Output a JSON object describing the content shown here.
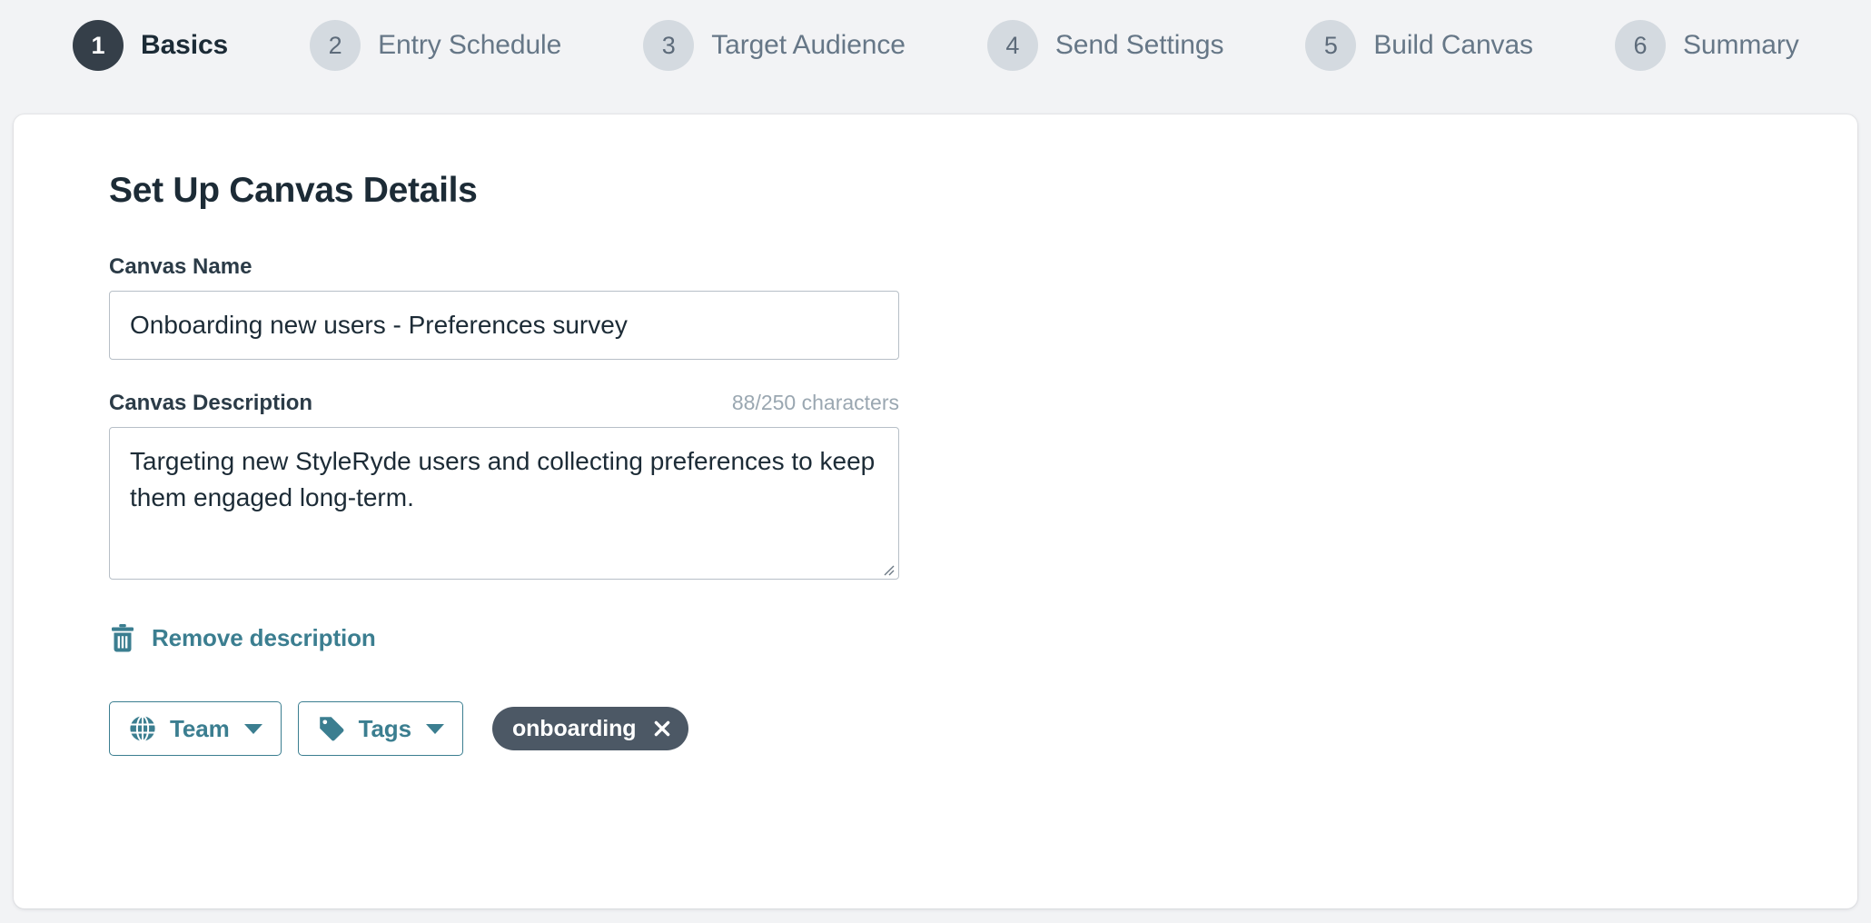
{
  "stepper": {
    "steps": [
      {
        "number": "1",
        "label": "Basics",
        "state": "active"
      },
      {
        "number": "2",
        "label": "Entry Schedule",
        "state": "inactive"
      },
      {
        "number": "3",
        "label": "Target Audience",
        "state": "inactive"
      },
      {
        "number": "4",
        "label": "Send Settings",
        "state": "inactive"
      },
      {
        "number": "5",
        "label": "Build Canvas",
        "state": "inactive"
      },
      {
        "number": "6",
        "label": "Summary",
        "state": "inactive"
      }
    ]
  },
  "main": {
    "title": "Set Up Canvas Details",
    "canvas_name": {
      "label": "Canvas Name",
      "value": "Onboarding new users - Preferences survey",
      "placeholder": "Canvas Name"
    },
    "canvas_description": {
      "label": "Canvas Description",
      "char_count": "88/250 characters",
      "value": "Targeting new StyleRyde users and collecting preferences to keep them engaged long-term.",
      "placeholder": "Canvas Description"
    },
    "remove_description": {
      "label": "Remove description",
      "icon": "trash-icon"
    },
    "team_button": {
      "label": "Team",
      "icon": "globe-icon",
      "caret": "chevron-down-icon"
    },
    "tags_button": {
      "label": "Tags",
      "icon": "tag-icon",
      "caret": "chevron-down-icon"
    },
    "tags": [
      {
        "label": "onboarding",
        "remove_icon": "close-icon"
      }
    ]
  },
  "colors": {
    "page_background": "#f2f3f5",
    "card_background": "#ffffff",
    "accent_teal": "#3b7e90",
    "step_active": "#353f49",
    "step_inactive": "#d4dae0",
    "chip_background": "#4c5865",
    "input_border": "#b7bfc7",
    "muted_text": "#9aa7b1"
  }
}
